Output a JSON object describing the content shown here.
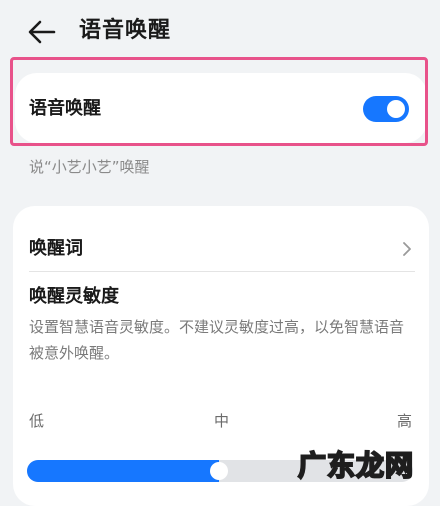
{
  "header": {
    "title": "语音唤醒",
    "back_icon": "arrow-left-icon"
  },
  "voice_wake": {
    "label": "语音唤醒",
    "enabled": true,
    "accent_color": "#1677ff"
  },
  "subtitle": "说“小艺小艺”唤醒",
  "wake_word": {
    "label": "唤醒词",
    "chevron_icon": "chevron-right-icon"
  },
  "sensitivity": {
    "title": "唤醒灵敏度",
    "description": "设置智慧语音灵敏度。不建议灵敏度过高，以免智慧语音被意外唤醒。",
    "ticks": {
      "low": "低",
      "mid": "中",
      "high": "高"
    },
    "value": 0.5
  },
  "watermark": "广东龙网",
  "highlight_color": "#e8528a"
}
